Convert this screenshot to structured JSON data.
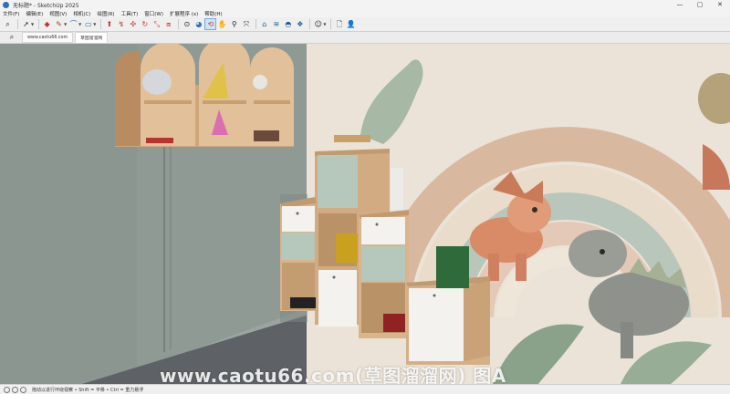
{
  "window": {
    "title": "无标题* - SketchUp 2025",
    "controls": [
      "—",
      "▢",
      "✕"
    ]
  },
  "menu": {
    "items": [
      "文件(F)",
      "编辑(E)",
      "视图(V)",
      "相机(C)",
      "绘图(R)",
      "工具(T)",
      "窗口(W)",
      "扩展程序 (x)",
      "帮助(H)"
    ]
  },
  "tabs": {
    "items": [
      "www.caotu66.com",
      "草图溜溜网"
    ],
    "active_index": 1
  },
  "status": {
    "hint": "拖动以进行环绕视察 • Shift = 平移 • Ctrl = 重力悬浮"
  },
  "watermark": {
    "text": "www.caotu66.com(草图溜溜网) 图A"
  },
  "colors": {
    "wall_left": "#8f9a94",
    "floor": "#5e6166",
    "wood": "#d9b48c",
    "sage_door": "#b6c7bc",
    "white_door": "#f4f2ee",
    "mural_bg": "#ebe3d7"
  }
}
